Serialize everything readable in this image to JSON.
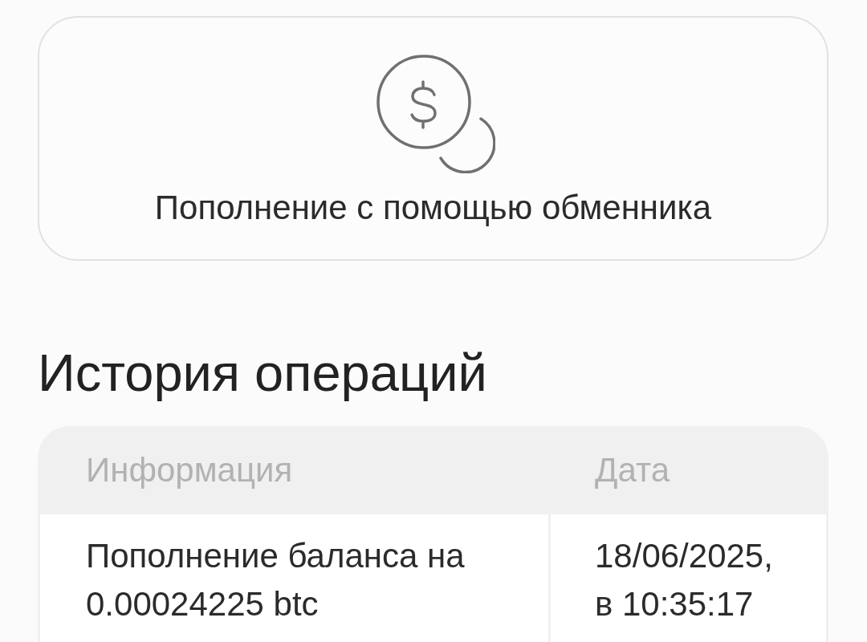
{
  "exchange_card": {
    "label": "Пополнение с помощью обменника"
  },
  "history": {
    "title": "История операций",
    "table": {
      "columns": [
        "Информация",
        "Дата"
      ],
      "rows": [
        {
          "cells": [
            "Пополнение баланса на 0.00024225 btc",
            "18/06/2025, в 10:35:17"
          ]
        }
      ]
    }
  }
}
